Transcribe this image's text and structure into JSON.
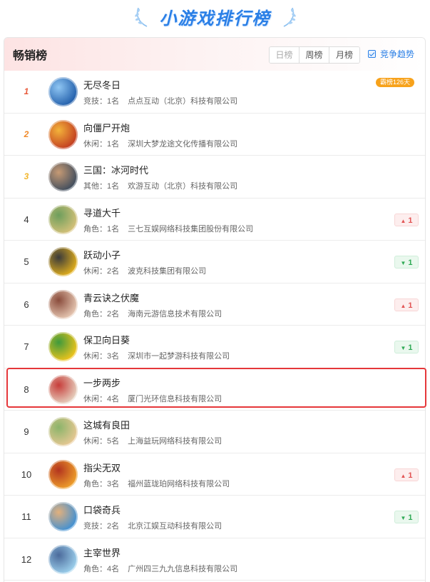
{
  "header": {
    "title": "小游戏排行榜"
  },
  "panel": {
    "title": "畅销榜",
    "tabs": [
      {
        "label": "日榜",
        "active": false
      },
      {
        "label": "周榜",
        "active": true
      },
      {
        "label": "月榜",
        "active": true
      }
    ],
    "trend_label": "竞争趋势"
  },
  "rows": [
    {
      "rank": "1",
      "name": "无尽冬日",
      "meta_left": "竞技：1名",
      "company": "点点互动（北京）科技有限公司",
      "badge": "霸榜126天",
      "change": null,
      "icon": "frozen-city-icon",
      "colors": [
        "#1e5ba8",
        "#8fc6f3"
      ]
    },
    {
      "rank": "2",
      "name": "向僵尸开炮",
      "meta_left": "休闲：1名",
      "company": "深圳大梦龙途文化传播有限公司",
      "change": null,
      "icon": "warrior-icon",
      "colors": [
        "#c0391f",
        "#f3b33a"
      ]
    },
    {
      "rank": "3",
      "name": "三国：冰河时代",
      "meta_left": "其他：1名",
      "company": "欢游互动（北京）科技有限公司",
      "change": null,
      "icon": "general-icon",
      "colors": [
        "#3b4a5c",
        "#c69a74"
      ]
    },
    {
      "rank": "4",
      "name": "寻道大千",
      "meta_left": "角色：1名",
      "company": "三七互娱网络科技集团股份有限公司",
      "change": {
        "dir": "up",
        "value": "1"
      },
      "icon": "sage-icon",
      "colors": [
        "#d8c27a",
        "#6d9e5c"
      ]
    },
    {
      "rank": "5",
      "name": "跃动小子",
      "meta_left": "休闲：2名",
      "company": "波克科技集团有限公司",
      "change": {
        "dir": "down",
        "value": "1"
      },
      "icon": "helmet-icon",
      "colors": [
        "#e6b21c",
        "#3a3a3a"
      ]
    },
    {
      "rank": "6",
      "name": "青云诀之伏魔",
      "meta_left": "角色：2名",
      "company": "海南元游信息技术有限公司",
      "change": {
        "dir": "up",
        "value": "1"
      },
      "icon": "heroine-icon",
      "colors": [
        "#e9cbb6",
        "#8a4c3c"
      ]
    },
    {
      "rank": "7",
      "name": "保卫向日葵",
      "meta_left": "休闲：3名",
      "company": "深圳市一起梦游科技有限公司",
      "change": {
        "dir": "down",
        "value": "1"
      },
      "icon": "sunflower-icon",
      "colors": [
        "#f4c51b",
        "#3f9a3c"
      ]
    },
    {
      "rank": "8",
      "name": "一步两步",
      "meta_left": "休闲：4名",
      "company": "厦门光环信息科技有限公司",
      "change": null,
      "icon": "cow-icon",
      "colors": [
        "#e7d5c3",
        "#c73d3a"
      ]
    },
    {
      "rank": "9",
      "name": "这城有良田",
      "meta_left": "休闲：5名",
      "company": "上海益玩网络科技有限公司",
      "change": null,
      "icon": "farm-icon",
      "colors": [
        "#e9c894",
        "#8bb46a"
      ]
    },
    {
      "rank": "10",
      "name": "指尖无双",
      "meta_left": "角色：3名",
      "company": "福州蓝珑珀网络科技有限公司",
      "change": {
        "dir": "up",
        "value": "1"
      },
      "icon": "monkey-king-icon",
      "colors": [
        "#f0a22b",
        "#b3341f"
      ]
    },
    {
      "rank": "11",
      "name": "口袋奇兵",
      "meta_left": "竞技：2名",
      "company": "北京江娱互动科技有限公司",
      "change": {
        "dir": "down",
        "value": "1"
      },
      "icon": "soldier-icon",
      "colors": [
        "#3b8fd6",
        "#e2b07c"
      ]
    },
    {
      "rank": "12",
      "name": "主宰世界",
      "meta_left": "角色：4名",
      "company": "广州四三九九信息科技有限公司",
      "change": null,
      "icon": "dragon-knight-icon",
      "colors": [
        "#9fd3ef",
        "#4b6a9b"
      ]
    }
  ]
}
